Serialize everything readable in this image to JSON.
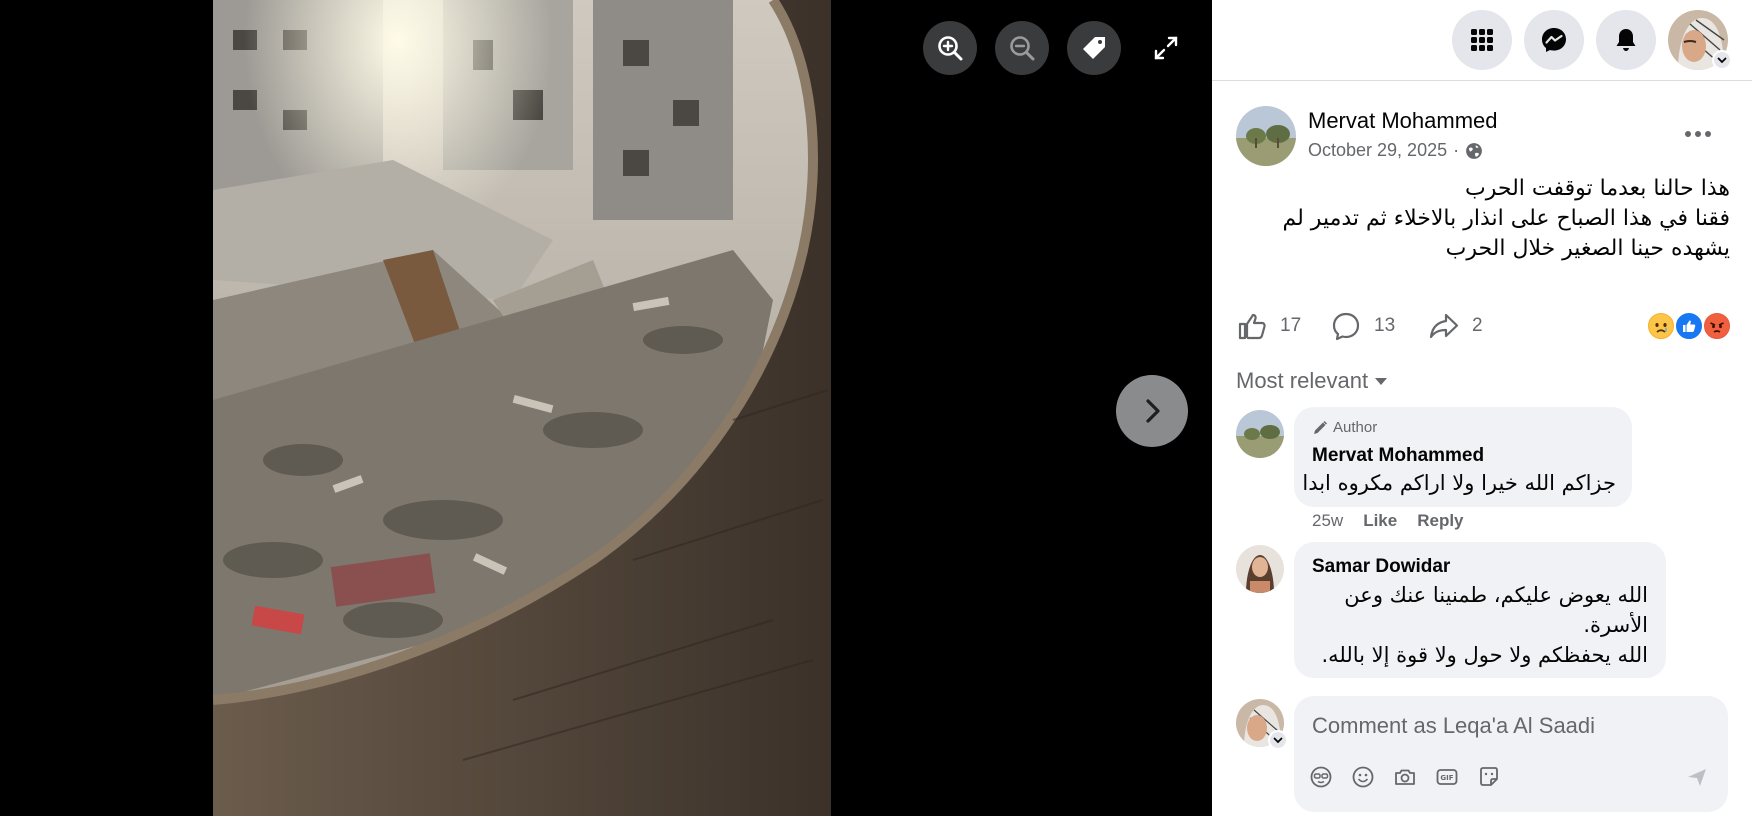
{
  "viewer": {
    "photo_alt": "",
    "controls": {
      "zoom_in_icon": "zoom-in-icon",
      "zoom_out_icon": "zoom-out-icon",
      "tag_icon": "tag-icon",
      "fullscreen_icon": "fullscreen-icon",
      "next_icon": "chevron-right-icon"
    }
  },
  "topbar": {
    "menu_icon": "grid-menu-icon",
    "messenger_icon": "messenger-icon",
    "notifications_icon": "bell-icon"
  },
  "post": {
    "author": "Mervat Mohammed",
    "date": "October 29, 2025",
    "date_separator": "·",
    "privacy_icon": "globe-icon",
    "text_lines": [
      "هذا حالنا بعدما توقفت الحرب",
      "فقنا في هذا الصباح على انذار بالاخلاء ثم تدمير لم",
      "يشهده حينا الصغير خلال الحرب"
    ],
    "likes": "17",
    "comments": "13",
    "shares": "2",
    "reactions": [
      "sad",
      "like",
      "angry"
    ]
  },
  "comments_sort": "Most relevant",
  "comments": [
    {
      "badge": "Author",
      "author": "Mervat Mohammed",
      "text": "جزاكم الله خيرا ولا اراكم مكروه ابدا",
      "time": "25w",
      "like_label": "Like",
      "reply_label": "Reply"
    },
    {
      "author": "Samar Dowidar",
      "text_lines": [
        "الله يعوض عليكم، طمنينا عنك وعن",
        "الأسرة.",
        "الله يحفظكم ولا حول ولا قوة إلا بالله."
      ]
    }
  ],
  "composer": {
    "placeholder": "Comment as Leqa'a Al Saadi"
  },
  "colors": {
    "panel_bg": "#ffffff",
    "bubble_bg": "#f0f2f5",
    "secondary_text": "#65676b",
    "primary_text": "#050505",
    "like_blue": "#1877f2"
  }
}
